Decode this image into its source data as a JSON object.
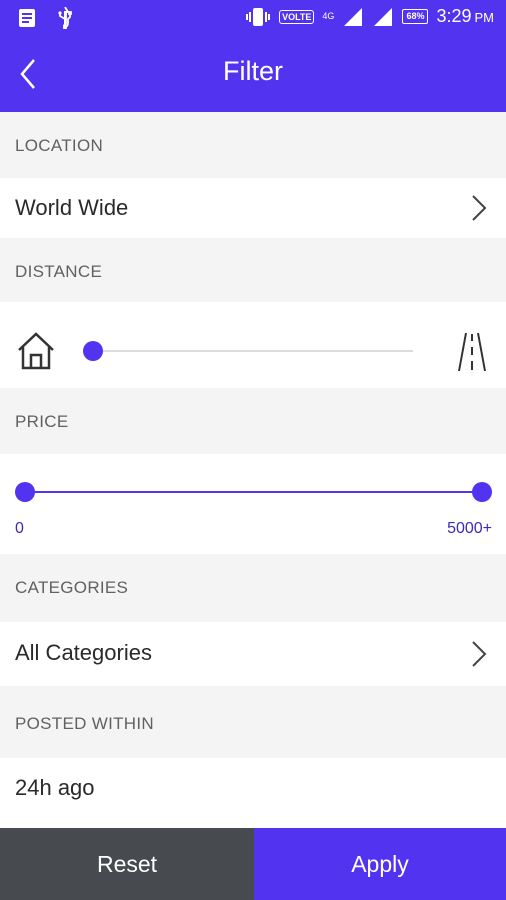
{
  "status_bar": {
    "volte": "VOLTE",
    "network": "4G",
    "battery": "68%",
    "time": "3:29",
    "ampm": "PM"
  },
  "header": {
    "title": "Filter",
    "back_icon": "chevron-left-icon"
  },
  "location": {
    "label": "LOCATION",
    "value": "World Wide"
  },
  "distance": {
    "label": "DISTANCE",
    "min_icon": "home-icon",
    "max_icon": "road-icon",
    "value_fraction": 0.0
  },
  "price": {
    "label": "PRICE",
    "min_label": "0",
    "max_label": "5000+",
    "range": [
      0,
      1
    ]
  },
  "categories": {
    "label": "CATEGORIES",
    "value": "All Categories"
  },
  "posted_within": {
    "label": "POSTED WITHIN",
    "value": "24h ago"
  },
  "actions": {
    "reset": "Reset",
    "apply": "Apply"
  },
  "colors": {
    "accent": "#5234f0",
    "reset_bg": "#474b4f"
  }
}
